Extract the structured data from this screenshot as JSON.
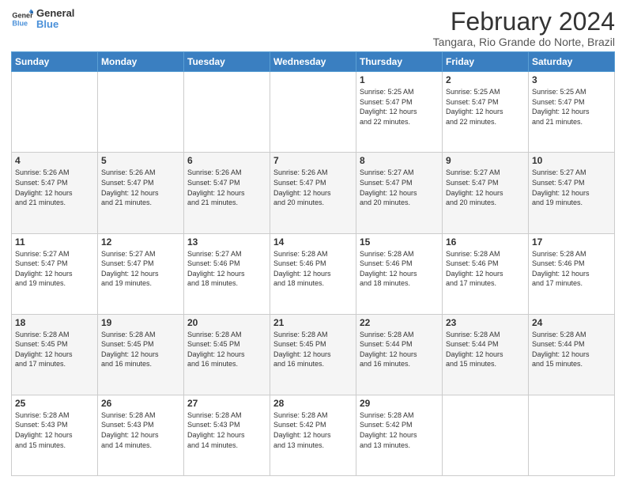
{
  "logo": {
    "line1": "General",
    "line2": "Blue"
  },
  "title": "February 2024",
  "subtitle": "Tangara, Rio Grande do Norte, Brazil",
  "header_days": [
    "Sunday",
    "Monday",
    "Tuesday",
    "Wednesday",
    "Thursday",
    "Friday",
    "Saturday"
  ],
  "weeks": [
    [
      {
        "day": "",
        "info": ""
      },
      {
        "day": "",
        "info": ""
      },
      {
        "day": "",
        "info": ""
      },
      {
        "day": "",
        "info": ""
      },
      {
        "day": "1",
        "info": "Sunrise: 5:25 AM\nSunset: 5:47 PM\nDaylight: 12 hours\nand 22 minutes."
      },
      {
        "day": "2",
        "info": "Sunrise: 5:25 AM\nSunset: 5:47 PM\nDaylight: 12 hours\nand 22 minutes."
      },
      {
        "day": "3",
        "info": "Sunrise: 5:25 AM\nSunset: 5:47 PM\nDaylight: 12 hours\nand 21 minutes."
      }
    ],
    [
      {
        "day": "4",
        "info": "Sunrise: 5:26 AM\nSunset: 5:47 PM\nDaylight: 12 hours\nand 21 minutes."
      },
      {
        "day": "5",
        "info": "Sunrise: 5:26 AM\nSunset: 5:47 PM\nDaylight: 12 hours\nand 21 minutes."
      },
      {
        "day": "6",
        "info": "Sunrise: 5:26 AM\nSunset: 5:47 PM\nDaylight: 12 hours\nand 21 minutes."
      },
      {
        "day": "7",
        "info": "Sunrise: 5:26 AM\nSunset: 5:47 PM\nDaylight: 12 hours\nand 20 minutes."
      },
      {
        "day": "8",
        "info": "Sunrise: 5:27 AM\nSunset: 5:47 PM\nDaylight: 12 hours\nand 20 minutes."
      },
      {
        "day": "9",
        "info": "Sunrise: 5:27 AM\nSunset: 5:47 PM\nDaylight: 12 hours\nand 20 minutes."
      },
      {
        "day": "10",
        "info": "Sunrise: 5:27 AM\nSunset: 5:47 PM\nDaylight: 12 hours\nand 19 minutes."
      }
    ],
    [
      {
        "day": "11",
        "info": "Sunrise: 5:27 AM\nSunset: 5:47 PM\nDaylight: 12 hours\nand 19 minutes."
      },
      {
        "day": "12",
        "info": "Sunrise: 5:27 AM\nSunset: 5:47 PM\nDaylight: 12 hours\nand 19 minutes."
      },
      {
        "day": "13",
        "info": "Sunrise: 5:27 AM\nSunset: 5:46 PM\nDaylight: 12 hours\nand 18 minutes."
      },
      {
        "day": "14",
        "info": "Sunrise: 5:28 AM\nSunset: 5:46 PM\nDaylight: 12 hours\nand 18 minutes."
      },
      {
        "day": "15",
        "info": "Sunrise: 5:28 AM\nSunset: 5:46 PM\nDaylight: 12 hours\nand 18 minutes."
      },
      {
        "day": "16",
        "info": "Sunrise: 5:28 AM\nSunset: 5:46 PM\nDaylight: 12 hours\nand 17 minutes."
      },
      {
        "day": "17",
        "info": "Sunrise: 5:28 AM\nSunset: 5:46 PM\nDaylight: 12 hours\nand 17 minutes."
      }
    ],
    [
      {
        "day": "18",
        "info": "Sunrise: 5:28 AM\nSunset: 5:45 PM\nDaylight: 12 hours\nand 17 minutes."
      },
      {
        "day": "19",
        "info": "Sunrise: 5:28 AM\nSunset: 5:45 PM\nDaylight: 12 hours\nand 16 minutes."
      },
      {
        "day": "20",
        "info": "Sunrise: 5:28 AM\nSunset: 5:45 PM\nDaylight: 12 hours\nand 16 minutes."
      },
      {
        "day": "21",
        "info": "Sunrise: 5:28 AM\nSunset: 5:45 PM\nDaylight: 12 hours\nand 16 minutes."
      },
      {
        "day": "22",
        "info": "Sunrise: 5:28 AM\nSunset: 5:44 PM\nDaylight: 12 hours\nand 16 minutes."
      },
      {
        "day": "23",
        "info": "Sunrise: 5:28 AM\nSunset: 5:44 PM\nDaylight: 12 hours\nand 15 minutes."
      },
      {
        "day": "24",
        "info": "Sunrise: 5:28 AM\nSunset: 5:44 PM\nDaylight: 12 hours\nand 15 minutes."
      }
    ],
    [
      {
        "day": "25",
        "info": "Sunrise: 5:28 AM\nSunset: 5:43 PM\nDaylight: 12 hours\nand 15 minutes."
      },
      {
        "day": "26",
        "info": "Sunrise: 5:28 AM\nSunset: 5:43 PM\nDaylight: 12 hours\nand 14 minutes."
      },
      {
        "day": "27",
        "info": "Sunrise: 5:28 AM\nSunset: 5:43 PM\nDaylight: 12 hours\nand 14 minutes."
      },
      {
        "day": "28",
        "info": "Sunrise: 5:28 AM\nSunset: 5:42 PM\nDaylight: 12 hours\nand 13 minutes."
      },
      {
        "day": "29",
        "info": "Sunrise: 5:28 AM\nSunset: 5:42 PM\nDaylight: 12 hours\nand 13 minutes."
      },
      {
        "day": "",
        "info": ""
      },
      {
        "day": "",
        "info": ""
      }
    ]
  ]
}
